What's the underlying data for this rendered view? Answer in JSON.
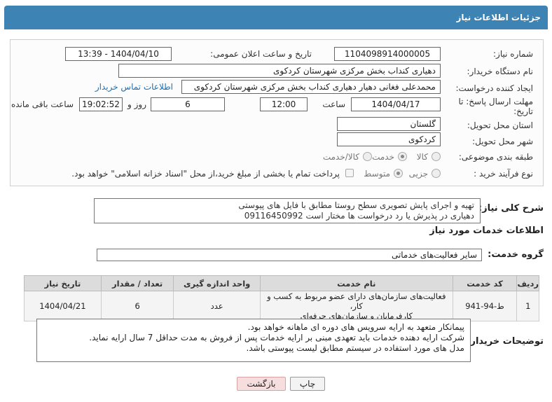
{
  "header": {
    "title": "جزئیات اطلاعات نیاز"
  },
  "fields": {
    "need_number_label": "شماره نیاز:",
    "need_number": "1104098914000005",
    "announce_label": "تاریخ و ساعت اعلان عمومی:",
    "announce_value": "1404/04/10 - 13:39",
    "buyer_org_label": "نام دستگاه خریدار:",
    "buyer_org": "دهیاری کنداب بخش مرکزی شهرستان کردکوی",
    "requester_label": "ایجاد کننده درخواست:",
    "requester": "محمدعلی فغانی دهیار دهیاری کنداب بخش مرکزی شهرستان کردکوی",
    "contact_link": "اطلاعات تماس خریدار",
    "deadline_label": "مهلت ارسال پاسخ: تا تاریخ:",
    "deadline_date": "1404/04/17",
    "time_label": "ساعت",
    "deadline_time": "12:00",
    "days_value": "6",
    "days_label": "روز و",
    "remaining_time": "19:02:52",
    "remaining_label": "ساعت باقی مانده",
    "province_label": "استان محل تحویل:",
    "province": "گلستان",
    "city_label": "شهر محل تحویل:",
    "city": "کردکوی",
    "category_label": "طبقه بندی موضوعی:",
    "category_options": [
      "کالا",
      "خدمت",
      "کالا/خدمت"
    ],
    "process_label": "نوع فرآیند خرید :",
    "process_options": [
      "جزیی",
      "متوسط"
    ],
    "payment_note": "پرداخت تمام یا بخشی از مبلغ خرید،از محل \"اسناد خزانه اسلامی\" خواهد بود."
  },
  "summary": {
    "label": "شرح کلی نیاز:",
    "line1": "تهیه و اجرای پایش تصویری سطح روستا مطابق با فایل های پیوستی",
    "line2": "دهیاری در پذیرش یا رد درخواست ها مختار است  09116450992"
  },
  "services": {
    "title": "اطلاعات خدمات مورد نیاز",
    "group_label": "گروه خدمت:",
    "group_value": "سایر فعالیت‌های خدماتی",
    "columns": [
      "ردیف",
      "کد خدمت",
      "نام خدمت",
      "واحد اندازه گیری",
      "تعداد / مقدار",
      "تاریخ نیاز"
    ],
    "rows": [
      {
        "index": "1",
        "code": "ط-94-941",
        "name_line1": "فعالیت‌های سازمان‌های دارای عضو مربوط به کسب و کار،",
        "name_line2": "کارفرمایان و سازمان‌های حرفه‌ای",
        "unit": "عدد",
        "qty": "6",
        "date": "1404/04/21"
      }
    ]
  },
  "buyer_notes": {
    "label": "توضیحات خریدار:",
    "line1": "پیمانکار متعهد به ارایه سرویس های دوره ای ماهانه خواهد بود.",
    "line2": "شرکت ارایه دهنده خدمات باید تعهدی مبنی بر ارایه خدمات پس از فروش به مدت حداقل 7 سال ارایه نماید.",
    "line3": "مدل های مورد استفاده در سیستم مطابق لیست پیوستی باشد."
  },
  "buttons": {
    "print": "چاپ",
    "back": "بازگشت"
  }
}
